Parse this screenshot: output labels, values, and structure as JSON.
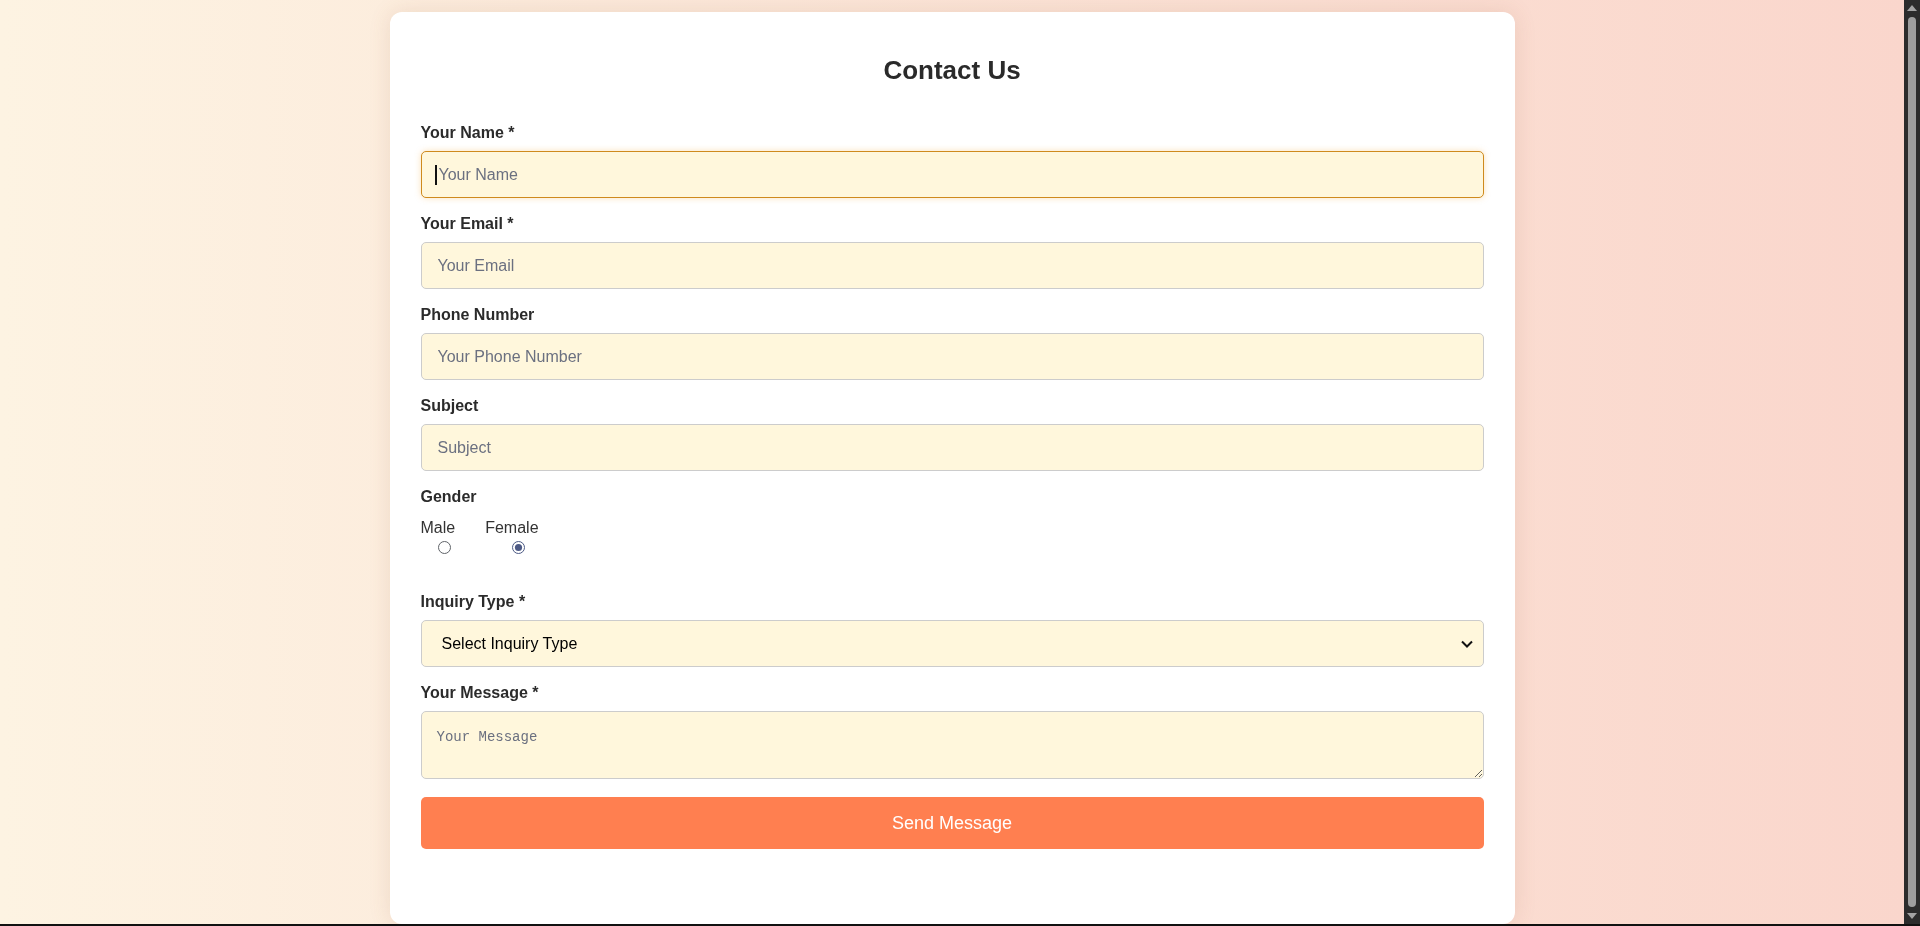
{
  "form": {
    "title": "Contact Us",
    "fields": [
      {
        "kind": "text",
        "label": "Your Name *",
        "placeholder": "Your Name",
        "focused": true
      },
      {
        "kind": "text",
        "label": "Your Email *",
        "placeholder": "Your Email",
        "focused": false
      },
      {
        "kind": "text",
        "label": "Phone Number",
        "placeholder": "Your Phone Number",
        "focused": false
      },
      {
        "kind": "text",
        "label": "Subject",
        "placeholder": "Subject",
        "focused": false
      },
      {
        "kind": "radio",
        "label": "Gender",
        "options": [
          {
            "label": "Male",
            "selected": false
          },
          {
            "label": "Female",
            "selected": true
          }
        ]
      },
      {
        "kind": "select",
        "label": "Inquiry Type *",
        "value": "Select Inquiry Type",
        "focused": false
      },
      {
        "kind": "textarea",
        "label": "Your Message *",
        "placeholder": "Your Message",
        "focused": false
      }
    ],
    "submit_button": {
      "label": "Send Message"
    }
  }
}
